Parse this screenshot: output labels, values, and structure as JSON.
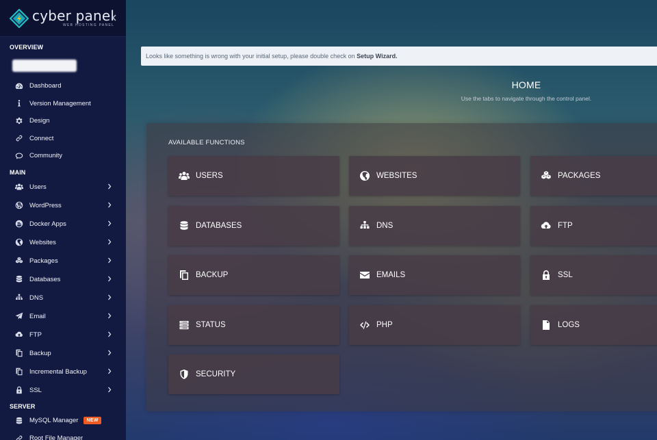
{
  "brand": {
    "name": "cyber panel",
    "tagline": "WEB HOSTING PANEL"
  },
  "sidebar": {
    "overview_label": "OVERVIEW",
    "overview_items": [
      {
        "label": "Dashboard",
        "icon": "dashboard-icon"
      },
      {
        "label": "Version Management",
        "icon": "info-icon"
      },
      {
        "label": "Design",
        "icon": "gear-icon"
      },
      {
        "label": "Connect",
        "icon": "link-icon"
      },
      {
        "label": "Community",
        "icon": "comments-icon"
      }
    ],
    "main_label": "MAIN",
    "main_items": [
      {
        "label": "Users",
        "icon": "users-icon"
      },
      {
        "label": "WordPress",
        "icon": "wordpress-icon"
      },
      {
        "label": "Docker Apps",
        "icon": "docker-icon"
      },
      {
        "label": "Websites",
        "icon": "globe-icon"
      },
      {
        "label": "Packages",
        "icon": "cubes-icon"
      },
      {
        "label": "Databases",
        "icon": "database-icon"
      },
      {
        "label": "DNS",
        "icon": "sitemap-icon"
      },
      {
        "label": "Email",
        "icon": "paper-plane-icon"
      },
      {
        "label": "FTP",
        "icon": "cloud-upload-icon"
      },
      {
        "label": "Backup",
        "icon": "copy-icon"
      },
      {
        "label": "Incremental Backup",
        "icon": "copy-icon"
      },
      {
        "label": "SSL",
        "icon": "lock-icon"
      }
    ],
    "server_label": "SERVER",
    "server_items": [
      {
        "label": "MySQL Manager",
        "icon": "database-icon",
        "badge": "NEW"
      },
      {
        "label": "Root File Manager",
        "icon": "link-icon"
      }
    ]
  },
  "alert": {
    "text": "Looks like something is wrong with your initial setup, please double check on ",
    "link": "Setup Wizard."
  },
  "home": {
    "title": "HOME",
    "subtitle": "Use the tabs to navigate through the control panel."
  },
  "functions": {
    "title": "AVAILABLE FUNCTIONS",
    "tiles": [
      {
        "label": "USERS",
        "icon": "users-icon"
      },
      {
        "label": "WEBSITES",
        "icon": "globe-icon"
      },
      {
        "label": "PACKAGES",
        "icon": "cubes-icon"
      },
      {
        "label": "DATABASES",
        "icon": "database-icon"
      },
      {
        "label": "DNS",
        "icon": "sitemap-icon"
      },
      {
        "label": "FTP",
        "icon": "cloud-upload-icon"
      },
      {
        "label": "BACKUP",
        "icon": "copy-icon"
      },
      {
        "label": "EMAILS",
        "icon": "envelope-icon"
      },
      {
        "label": "SSL",
        "icon": "lock-icon"
      },
      {
        "label": "STATUS",
        "icon": "server-icon"
      },
      {
        "label": "PHP",
        "icon": "code-icon"
      },
      {
        "label": "LOGS",
        "icon": "file-icon"
      },
      {
        "label": "SECURITY",
        "icon": "shield-icon"
      }
    ]
  },
  "colors": {
    "sidebar_bg": "#121a42",
    "badge_new": "#ef5a22",
    "logo_accent": "#20c2c9"
  }
}
